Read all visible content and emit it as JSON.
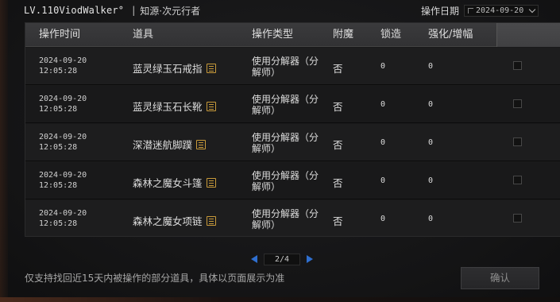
{
  "header": {
    "username": "LV.110ViodWalker°",
    "separator": "|",
    "subtitle": "知源·次元行者",
    "date_label": "操作日期",
    "date_value": "2024-09-20"
  },
  "table": {
    "columns": [
      "操作时间",
      "道具",
      "操作类型",
      "附魔",
      "锁造",
      "强化/增幅"
    ],
    "rows": [
      {
        "date": "2024-09-20",
        "time": "12:05:28",
        "item": "蓝灵绿玉石戒指",
        "op_line1": "使用分解器（分",
        "op_line2": "解师）",
        "enchant": "否",
        "lock": "0",
        "enhance": "0"
      },
      {
        "date": "2024-09-20",
        "time": "12:05:28",
        "item": "蓝灵绿玉石长靴",
        "op_line1": "使用分解器（分",
        "op_line2": "解师）",
        "enchant": "否",
        "lock": "0",
        "enhance": "0"
      },
      {
        "date": "2024-09-20",
        "time": "12:05:28",
        "item": "深潜迷航脚蹼",
        "op_line1": "使用分解器（分",
        "op_line2": "解师）",
        "enchant": "否",
        "lock": "0",
        "enhance": "0"
      },
      {
        "date": "2024-09-20",
        "time": "12:05:28",
        "item": "森林之魔女斗篷",
        "op_line1": "使用分解器（分",
        "op_line2": "解师）",
        "enchant": "否",
        "lock": "0",
        "enhance": "0"
      },
      {
        "date": "2024-09-20",
        "time": "12:05:28",
        "item": "森林之魔女项链",
        "op_line1": "使用分解器（分",
        "op_line2": "解师）",
        "enchant": "否",
        "lock": "0",
        "enhance": "0"
      }
    ]
  },
  "pagination": {
    "label": "2/4"
  },
  "footer": {
    "note": "仅支持找回近15天内被操作的部分道具，具体以页面展示为准",
    "confirm_label": "确认"
  },
  "colors": {
    "accent_icon": "#c89a3a",
    "pager_arrow": "#2f6fd0"
  }
}
